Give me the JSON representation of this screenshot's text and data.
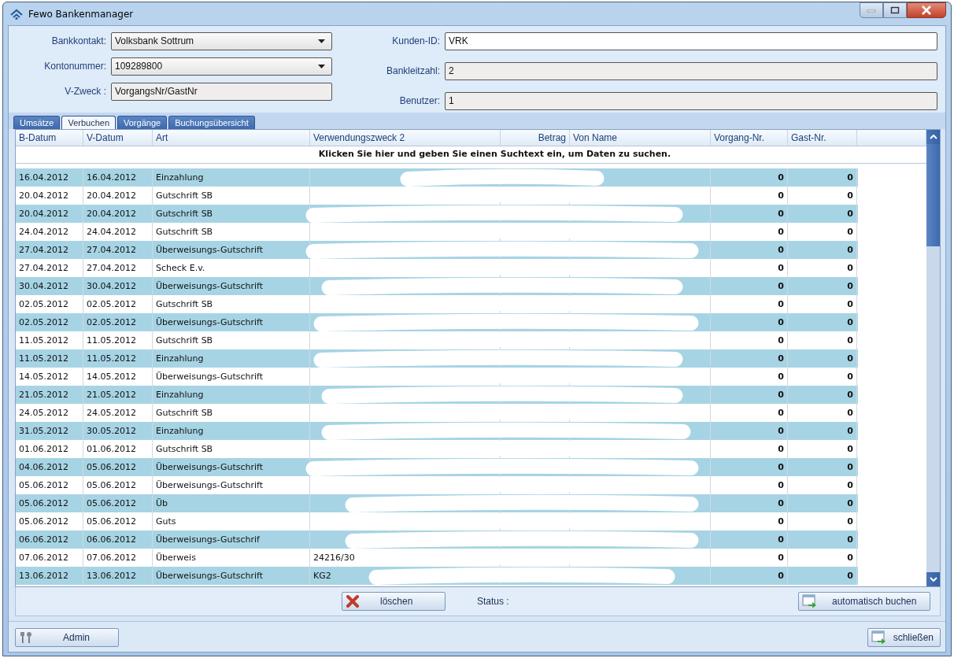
{
  "window": {
    "title": "Fewo Bankenmanager"
  },
  "form": {
    "left_fields": [
      {
        "label": "Bankkontakt:",
        "value": "Volksbank Sottrum",
        "kind": "dropdown"
      },
      {
        "label": "Kontonummer:",
        "value": "109289800",
        "kind": "dropdown"
      },
      {
        "label": "V-Zweck :",
        "value": "VorgangsNr/GastNr",
        "kind": "readonly"
      }
    ],
    "right_fields": [
      {
        "label": "Kunden-ID:",
        "value": "VRK",
        "kind": "text"
      },
      {
        "label": "Bankleitzahl:",
        "value": "2",
        "kind": "readonly"
      },
      {
        "label": "Benutzer:",
        "value": "1",
        "kind": "readonly"
      }
    ]
  },
  "tabs": [
    {
      "label": "Umsätze",
      "selected": false
    },
    {
      "label": "Verbuchen",
      "selected": true
    },
    {
      "label": "Vorgänge",
      "selected": false
    },
    {
      "label": "Buchungsübersicht",
      "selected": false
    }
  ],
  "table": {
    "columns": [
      "B-Datum",
      "V-Datum",
      "Art",
      "Verwendungszweck 2",
      "Betrag",
      "Von Name",
      "Vorgang-Nr.",
      "Gast-Nr."
    ],
    "search_hint": "Klicken Sie hier und geben Sie einen Suchtext ein, um Daten zu suchen.",
    "rows": [
      {
        "b_datum": "16.04.2012",
        "v_datum": "16.04.2012",
        "art": "Einzahlung",
        "vorgang_nr": "0",
        "gast_nr": "0"
      },
      {
        "b_datum": "20.04.2012",
        "v_datum": "20.04.2012",
        "art": "Gutschrift SB",
        "vorgang_nr": "0",
        "gast_nr": "0"
      },
      {
        "b_datum": "20.04.2012",
        "v_datum": "20.04.2012",
        "art": "Gutschrift SB",
        "vorgang_nr": "0",
        "gast_nr": "0"
      },
      {
        "b_datum": "24.04.2012",
        "v_datum": "24.04.2012",
        "art": "Gutschrift SB",
        "vorgang_nr": "0",
        "gast_nr": "0"
      },
      {
        "b_datum": "27.04.2012",
        "v_datum": "27.04.2012",
        "art": "Überweisungs-Gutschrift",
        "vorgang_nr": "0",
        "gast_nr": "0"
      },
      {
        "b_datum": "27.04.2012",
        "v_datum": "27.04.2012",
        "art": "Scheck E.v.",
        "vorgang_nr": "0",
        "gast_nr": "0"
      },
      {
        "b_datum": "30.04.2012",
        "v_datum": "30.04.2012",
        "art": "Überweisungs-Gutschrift",
        "vorgang_nr": "0",
        "gast_nr": "0"
      },
      {
        "b_datum": "02.05.2012",
        "v_datum": "02.05.2012",
        "art": "Gutschrift SB",
        "vorgang_nr": "0",
        "gast_nr": "0"
      },
      {
        "b_datum": "02.05.2012",
        "v_datum": "02.05.2012",
        "art": "Überweisungs-Gutschrift",
        "vorgang_nr": "0",
        "gast_nr": "0"
      },
      {
        "b_datum": "11.05.2012",
        "v_datum": "11.05.2012",
        "art": "Gutschrift SB",
        "vorgang_nr": "0",
        "gast_nr": "0"
      },
      {
        "b_datum": "11.05.2012",
        "v_datum": "11.05.2012",
        "art": "Einzahlung",
        "vorgang_nr": "0",
        "gast_nr": "0"
      },
      {
        "b_datum": "14.05.2012",
        "v_datum": "14.05.2012",
        "art": "Überweisungs-Gutschrift",
        "vorgang_nr": "0",
        "gast_nr": "0"
      },
      {
        "b_datum": "21.05.2012",
        "v_datum": "21.05.2012",
        "art": "Einzahlung",
        "vorgang_nr": "0",
        "gast_nr": "0"
      },
      {
        "b_datum": "24.05.2012",
        "v_datum": "24.05.2012",
        "art": "Gutschrift SB",
        "vorgang_nr": "0",
        "gast_nr": "0"
      },
      {
        "b_datum": "31.05.2012",
        "v_datum": "30.05.2012",
        "art": "Einzahlung",
        "vorgang_nr": "0",
        "gast_nr": "0"
      },
      {
        "b_datum": "01.06.2012",
        "v_datum": "01.06.2012",
        "art": "Gutschrift SB",
        "vorgang_nr": "0",
        "gast_nr": "0"
      },
      {
        "b_datum": "04.06.2012",
        "v_datum": "05.06.2012",
        "art": "Überweisungs-Gutschrift",
        "vorgang_nr": "0",
        "gast_nr": "0"
      },
      {
        "b_datum": "05.06.2012",
        "v_datum": "05.06.2012",
        "art": "Überweisungs-Gutschrift",
        "vorgang_nr": "0",
        "gast_nr": "0"
      },
      {
        "b_datum": "05.06.2012",
        "v_datum": "05.06.2012",
        "art": "Üb",
        "vorgang_nr": "0",
        "gast_nr": "0"
      },
      {
        "b_datum": "05.06.2012",
        "v_datum": "05.06.2012",
        "art": "Guts",
        "vorgang_nr": "0",
        "gast_nr": "0"
      },
      {
        "b_datum": "06.06.2012",
        "v_datum": "06.06.2012",
        "art": "Überweisungs-Gutschrif",
        "vorgang_nr": "0",
        "gast_nr": "0"
      },
      {
        "b_datum": "07.06.2012",
        "v_datum": "07.06.2012",
        "art": "Überweis",
        "verwendungszweck_2": "24216/30",
        "vorgang_nr": "0",
        "gast_nr": "0"
      },
      {
        "b_datum": "13.06.2012",
        "v_datum": "13.06.2012",
        "art": "Überweisungs-Gutschrift",
        "verwendungszweck_2": "KG2",
        "vorgang_nr": "0",
        "gast_nr": "0"
      }
    ]
  },
  "action_bar": {
    "delete_button": "löschen",
    "status_label": "Status :",
    "auto_button": "automatisch buchen"
  },
  "footer": {
    "admin_button": "Admin",
    "close_button": "schließen"
  }
}
